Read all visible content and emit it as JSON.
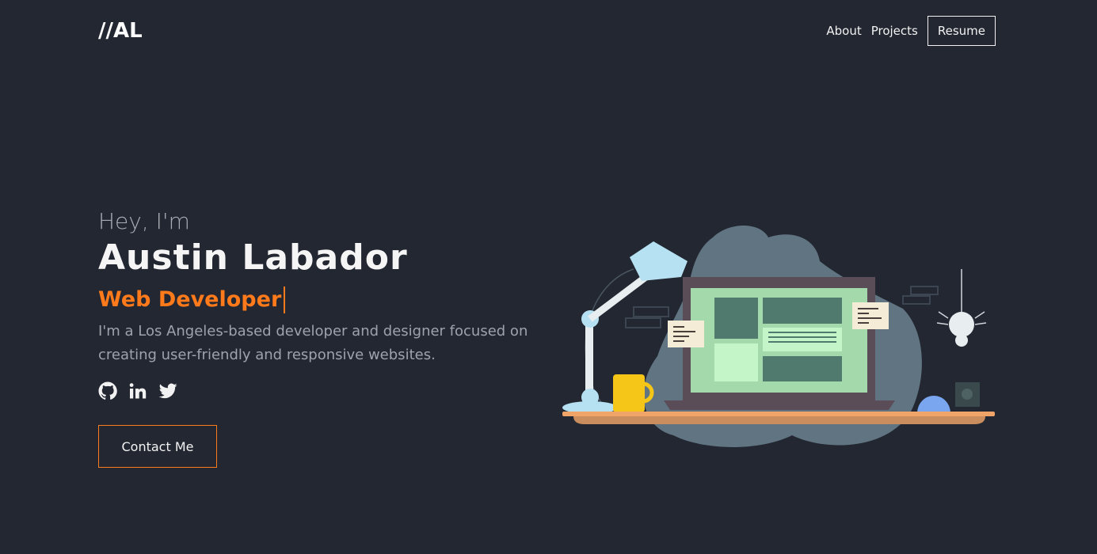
{
  "header": {
    "logo": "//AL",
    "nav": {
      "about": "About",
      "projects": "Projects",
      "resume": "Resume"
    }
  },
  "hero": {
    "greeting": "Hey, I'm",
    "name": "Austin Labador",
    "role": "Web Developer",
    "bio": "I'm a Los Angeles-based developer and designer focused on creating user-friendly and responsive websites.",
    "socials": [
      {
        "icon": "github-icon"
      },
      {
        "icon": "linkedin-icon"
      },
      {
        "icon": "twitter-icon"
      }
    ],
    "contact_label": "Contact Me"
  },
  "colors": {
    "background": "#222731",
    "accent": "#ff7a1a",
    "text": "#f5f5f5",
    "muted": "#9ea3ab"
  }
}
